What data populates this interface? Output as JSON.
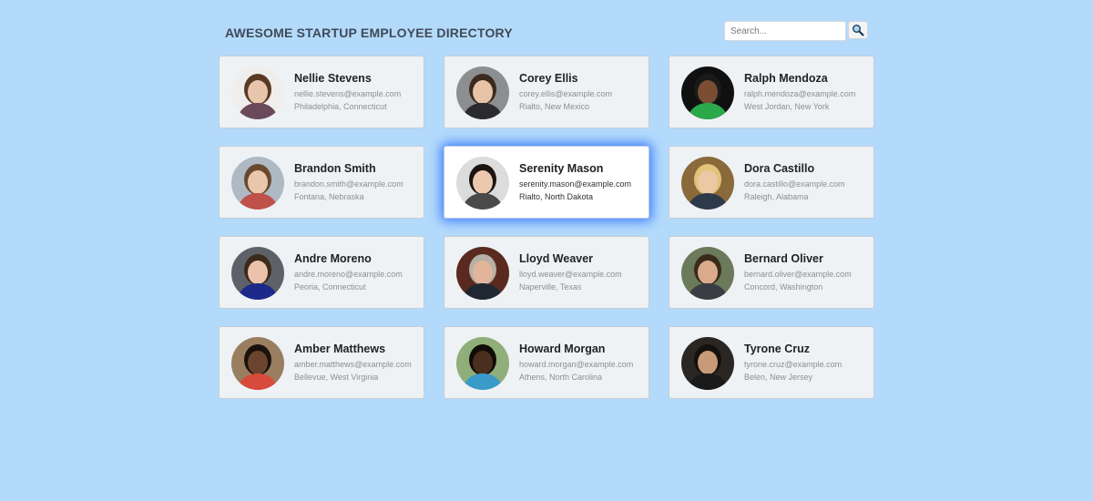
{
  "header": {
    "title": "Awesome Startup Employee Directory"
  },
  "search": {
    "placeholder": "Search...",
    "value": "",
    "button_icon": "magnifier-icon"
  },
  "employees": [
    {
      "name": "Nellie Stevens",
      "email": "nellie.stevens@example.com",
      "location": "Philadelphia, Connecticut",
      "avatar_bg": "#f0eeec",
      "avatar_skin": "#e8c5ad",
      "avatar_hair": "#5a3a22",
      "avatar_shirt": "#6a4a5a"
    },
    {
      "name": "Corey Ellis",
      "email": "corey.ellis@example.com",
      "location": "Rialto, New Mexico",
      "avatar_bg": "#8c8e90",
      "avatar_skin": "#e7c3a8",
      "avatar_hair": "#3b2a1e",
      "avatar_shirt": "#2b2b2f"
    },
    {
      "name": "Ralph Mendoza",
      "email": "ralph.mendoza@example.com",
      "location": "West Jordan, New York",
      "avatar_bg": "#101010",
      "avatar_skin": "#7a4e32",
      "avatar_hair": "#1a1a1a",
      "avatar_shirt": "#2aa84a"
    },
    {
      "name": "Brandon Smith",
      "email": "brandon.smith@example.com",
      "location": "Fontana, Nebraska",
      "avatar_bg": "#aeb9c4",
      "avatar_skin": "#eac6ac",
      "avatar_hair": "#6a4a2e",
      "avatar_shirt": "#c0504a"
    },
    {
      "name": "Serenity Mason",
      "email": "serenity.mason@example.com",
      "location": "Rialto, North Dakota",
      "avatar_bg": "#dcdcdc",
      "avatar_skin": "#ecc9ae",
      "avatar_hair": "#1c1410",
      "avatar_shirt": "#4a4a4a",
      "highlighted": true
    },
    {
      "name": "Dora Castillo",
      "email": "dora.castillo@example.com",
      "location": "Raleigh, Alabama",
      "avatar_bg": "#8a6a3a",
      "avatar_skin": "#ecc8a5",
      "avatar_hair": "#e3c27a",
      "avatar_shirt": "#2e3a4a"
    },
    {
      "name": "Andre Moreno",
      "email": "andre.moreno@example.com",
      "location": "Peoria, Connecticut",
      "avatar_bg": "#5e6268",
      "avatar_skin": "#ecc3aa",
      "avatar_hair": "#3c2a1c",
      "avatar_shirt": "#1d2a8a"
    },
    {
      "name": "Lloyd Weaver",
      "email": "lloyd.weaver@example.com",
      "location": "Naperville, Texas",
      "avatar_bg": "#5a2a20",
      "avatar_skin": "#e2b59a",
      "avatar_hair": "#b5b0a8",
      "avatar_shirt": "#1f2733"
    },
    {
      "name": "Bernard Oliver",
      "email": "bernard.oliver@example.com",
      "location": "Concord, Washington",
      "avatar_bg": "#6a7a5a",
      "avatar_skin": "#d9ab8c",
      "avatar_hair": "#3a2a1c",
      "avatar_shirt": "#3a3e44"
    },
    {
      "name": "Amber Matthews",
      "email": "amber.matthews@example.com",
      "location": "Bellevue, West Virginia",
      "avatar_bg": "#9a7e60",
      "avatar_skin": "#6b4430",
      "avatar_hair": "#1a120c",
      "avatar_shirt": "#d84a3a"
    },
    {
      "name": "Howard Morgan",
      "email": "howard.morgan@example.com",
      "location": "Athens, North Carolina",
      "avatar_bg": "#8fae7a",
      "avatar_skin": "#4a2e1e",
      "avatar_hair": "#120c08",
      "avatar_shirt": "#3a9ac8"
    },
    {
      "name": "Tyrone Cruz",
      "email": "tyrone.cruz@example.com",
      "location": "Belen, New Jersey",
      "avatar_bg": "#2a2622",
      "avatar_skin": "#c99a78",
      "avatar_hair": "#15100c",
      "avatar_shirt": "#1a1a1a"
    }
  ]
}
